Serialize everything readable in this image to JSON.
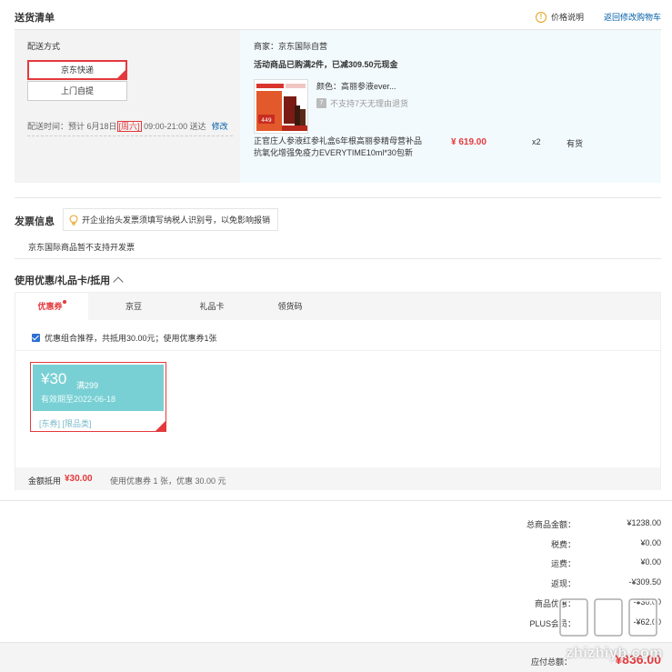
{
  "header": {
    "title": "送货清单",
    "price_note": "价格说明",
    "back_to_cart": "返回修改购物车"
  },
  "delivery": {
    "method_label": "配送方式",
    "options": [
      "京东快递",
      "上门自提"
    ],
    "selected_option": "京东快递",
    "time_label": "配送时间：",
    "time_prefix": "预计 6月18日",
    "weekday": "[周六]",
    "time_suffix": " 09:00-21:00 送达",
    "edit": "修改"
  },
  "order": {
    "merchant": "商家：京东国际自营",
    "promo": "活动商品已购满2件，已减309.50元现金",
    "color": "颜色：高丽参液ever...",
    "no_return": "不支持7天无理由退货",
    "no_return_icon": "7",
    "product_name": "正官庄人参液红参礼盒6年根高丽参精母营补品抗氧化增强免疫力EVERYTIME10ml*30包新",
    "price": "¥ 619.00",
    "qty": "x2",
    "stock": "有货",
    "img_badge": "449"
  },
  "invoice": {
    "title": "发票信息",
    "tip": "开企业抬头发票须填写纳税人识别号，以免影响报销",
    "note": "京东国际商品暂不支持开发票"
  },
  "coupons": {
    "title": "使用优惠/礼品卡/抵用",
    "tabs": [
      "优惠券",
      "京豆",
      "礼品卡",
      "领货码"
    ],
    "recommend": "优惠组合推荐，共抵用30.00元；使用优惠券1张",
    "card": {
      "amount": "¥30",
      "condition": "满299",
      "expiry": "有效期至2022-06-18",
      "tags": "[东券] [限品类]"
    },
    "footer_label": "金额抵用",
    "footer_amount": "¥30.00",
    "footer_desc": "使用优惠券 1 张，优惠 30.00 元"
  },
  "summary": {
    "rows": [
      {
        "k": "总商品金额：",
        "v": "¥1238.00"
      },
      {
        "k": "税费：",
        "v": "¥0.00"
      },
      {
        "k": "运费：",
        "v": "¥0.00"
      },
      {
        "k": "返现：",
        "v": "-¥309.50"
      },
      {
        "k": "商品优惠：",
        "v": "-¥30.00"
      },
      {
        "k": "PLUS会员：",
        "v": "-¥62.00"
      }
    ],
    "total_label": "应付总额：",
    "total_value": "¥836.00"
  },
  "watermark": {
    "text": "zhizhiyb.com"
  },
  "colors": {
    "accent_red": "#e4393c",
    "link_blue": "#005ea7",
    "coupon_teal": "#79d0d4"
  }
}
